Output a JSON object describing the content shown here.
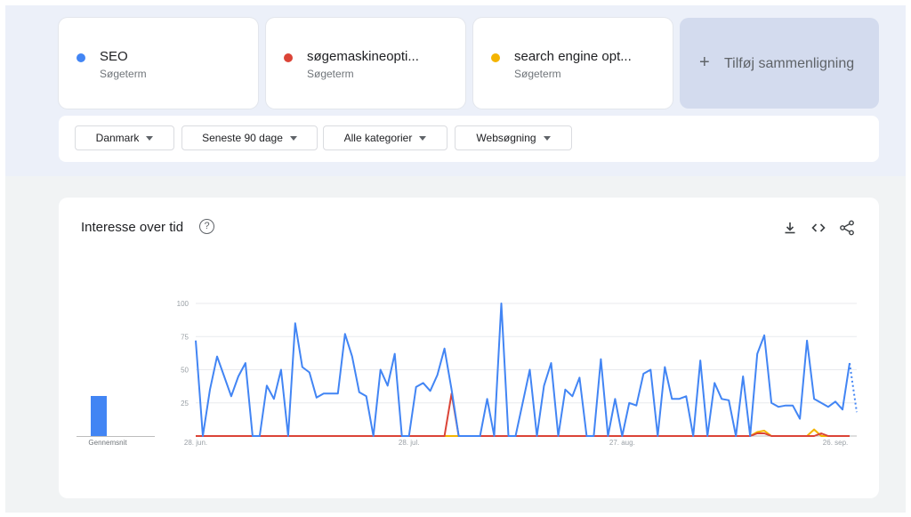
{
  "terms": [
    {
      "name": "SEO",
      "sub": "Søgeterm",
      "color": "#4285f4"
    },
    {
      "name": "søgemaskineopti...",
      "sub": "Søgeterm",
      "color": "#db4437"
    },
    {
      "name": "search engine opt...",
      "sub": "Søgeterm",
      "color": "#f4b400"
    }
  ],
  "add_compare": {
    "plus": "+",
    "label": "Tilføj sammenligning"
  },
  "filters": [
    {
      "label": "Danmark"
    },
    {
      "label": "Seneste 90 dage"
    },
    {
      "label": "Alle kategorier"
    },
    {
      "label": "Websøgning"
    }
  ],
  "chart_header": {
    "title": "Interesse over tid",
    "help_icon": "?",
    "tools": [
      "download-icon",
      "embed-icon",
      "share-icon"
    ]
  },
  "average": {
    "label": "Gennemsnit",
    "value": 30
  },
  "chart_data": {
    "type": "line",
    "title": "Interesse over tid",
    "ylim": [
      0,
      100
    ],
    "yticks": [
      100,
      75,
      50,
      25
    ],
    "xticks": [
      {
        "label": "28. jun.",
        "index": 0
      },
      {
        "label": "28. jul.",
        "index": 30
      },
      {
        "label": "27. aug.",
        "index": 60
      },
      {
        "label": "26. sep.",
        "index": 90
      }
    ],
    "grid": true,
    "series": [
      {
        "name": "SEO",
        "color": "#4285f4",
        "values": [
          72,
          0,
          35,
          60,
          45,
          30,
          45,
          55,
          0,
          0,
          38,
          28,
          50,
          0,
          85,
          52,
          48,
          29,
          32,
          32,
          32,
          77,
          60,
          33,
          30,
          0,
          50,
          38,
          62,
          0,
          0,
          37,
          40,
          34,
          46,
          66,
          35,
          0,
          0,
          0,
          0,
          28,
          0,
          100,
          0,
          0,
          25,
          50,
          0,
          38,
          55,
          0,
          35,
          30,
          44,
          0,
          0,
          58,
          0,
          28,
          0,
          25,
          23,
          47,
          50,
          0,
          52,
          28,
          28,
          30,
          0,
          57,
          0,
          40,
          28,
          27,
          0,
          45,
          0,
          62,
          76,
          25,
          22,
          23,
          23,
          13,
          72,
          28,
          25,
          22,
          26,
          20,
          55
        ],
        "partial_tail": [
          55,
          18
        ]
      },
      {
        "name": "søgemaskineopti...",
        "color": "#db4437",
        "values": [
          0,
          0,
          0,
          0,
          0,
          0,
          0,
          0,
          0,
          0,
          0,
          0,
          0,
          0,
          0,
          0,
          0,
          0,
          0,
          0,
          0,
          0,
          0,
          0,
          0,
          0,
          0,
          0,
          0,
          0,
          0,
          0,
          0,
          0,
          0,
          0,
          32,
          0,
          0,
          0,
          0,
          0,
          0,
          0,
          0,
          0,
          0,
          0,
          0,
          0,
          0,
          0,
          0,
          0,
          0,
          0,
          0,
          0,
          0,
          0,
          0,
          0,
          0,
          0,
          0,
          0,
          0,
          0,
          0,
          0,
          0,
          0,
          0,
          0,
          0,
          0,
          0,
          0,
          0,
          2,
          2,
          0,
          0,
          0,
          0,
          0,
          0,
          0,
          2,
          0,
          0,
          0,
          0
        ]
      },
      {
        "name": "search engine opt...",
        "color": "#f4b400",
        "values": [
          0,
          0,
          0,
          0,
          0,
          0,
          0,
          0,
          0,
          0,
          0,
          0,
          0,
          0,
          0,
          0,
          0,
          0,
          0,
          0,
          0,
          0,
          0,
          0,
          0,
          0,
          0,
          0,
          0,
          0,
          0,
          0,
          0,
          0,
          0,
          0,
          0,
          0,
          0,
          0,
          0,
          0,
          0,
          0,
          0,
          0,
          0,
          0,
          0,
          0,
          0,
          0,
          0,
          0,
          0,
          0,
          0,
          0,
          0,
          0,
          0,
          0,
          0,
          0,
          0,
          0,
          0,
          0,
          0,
          0,
          0,
          0,
          0,
          0,
          0,
          0,
          0,
          0,
          0,
          3,
          4,
          0,
          0,
          0,
          0,
          0,
          0,
          5,
          0,
          0,
          0,
          0,
          0
        ]
      }
    ]
  }
}
